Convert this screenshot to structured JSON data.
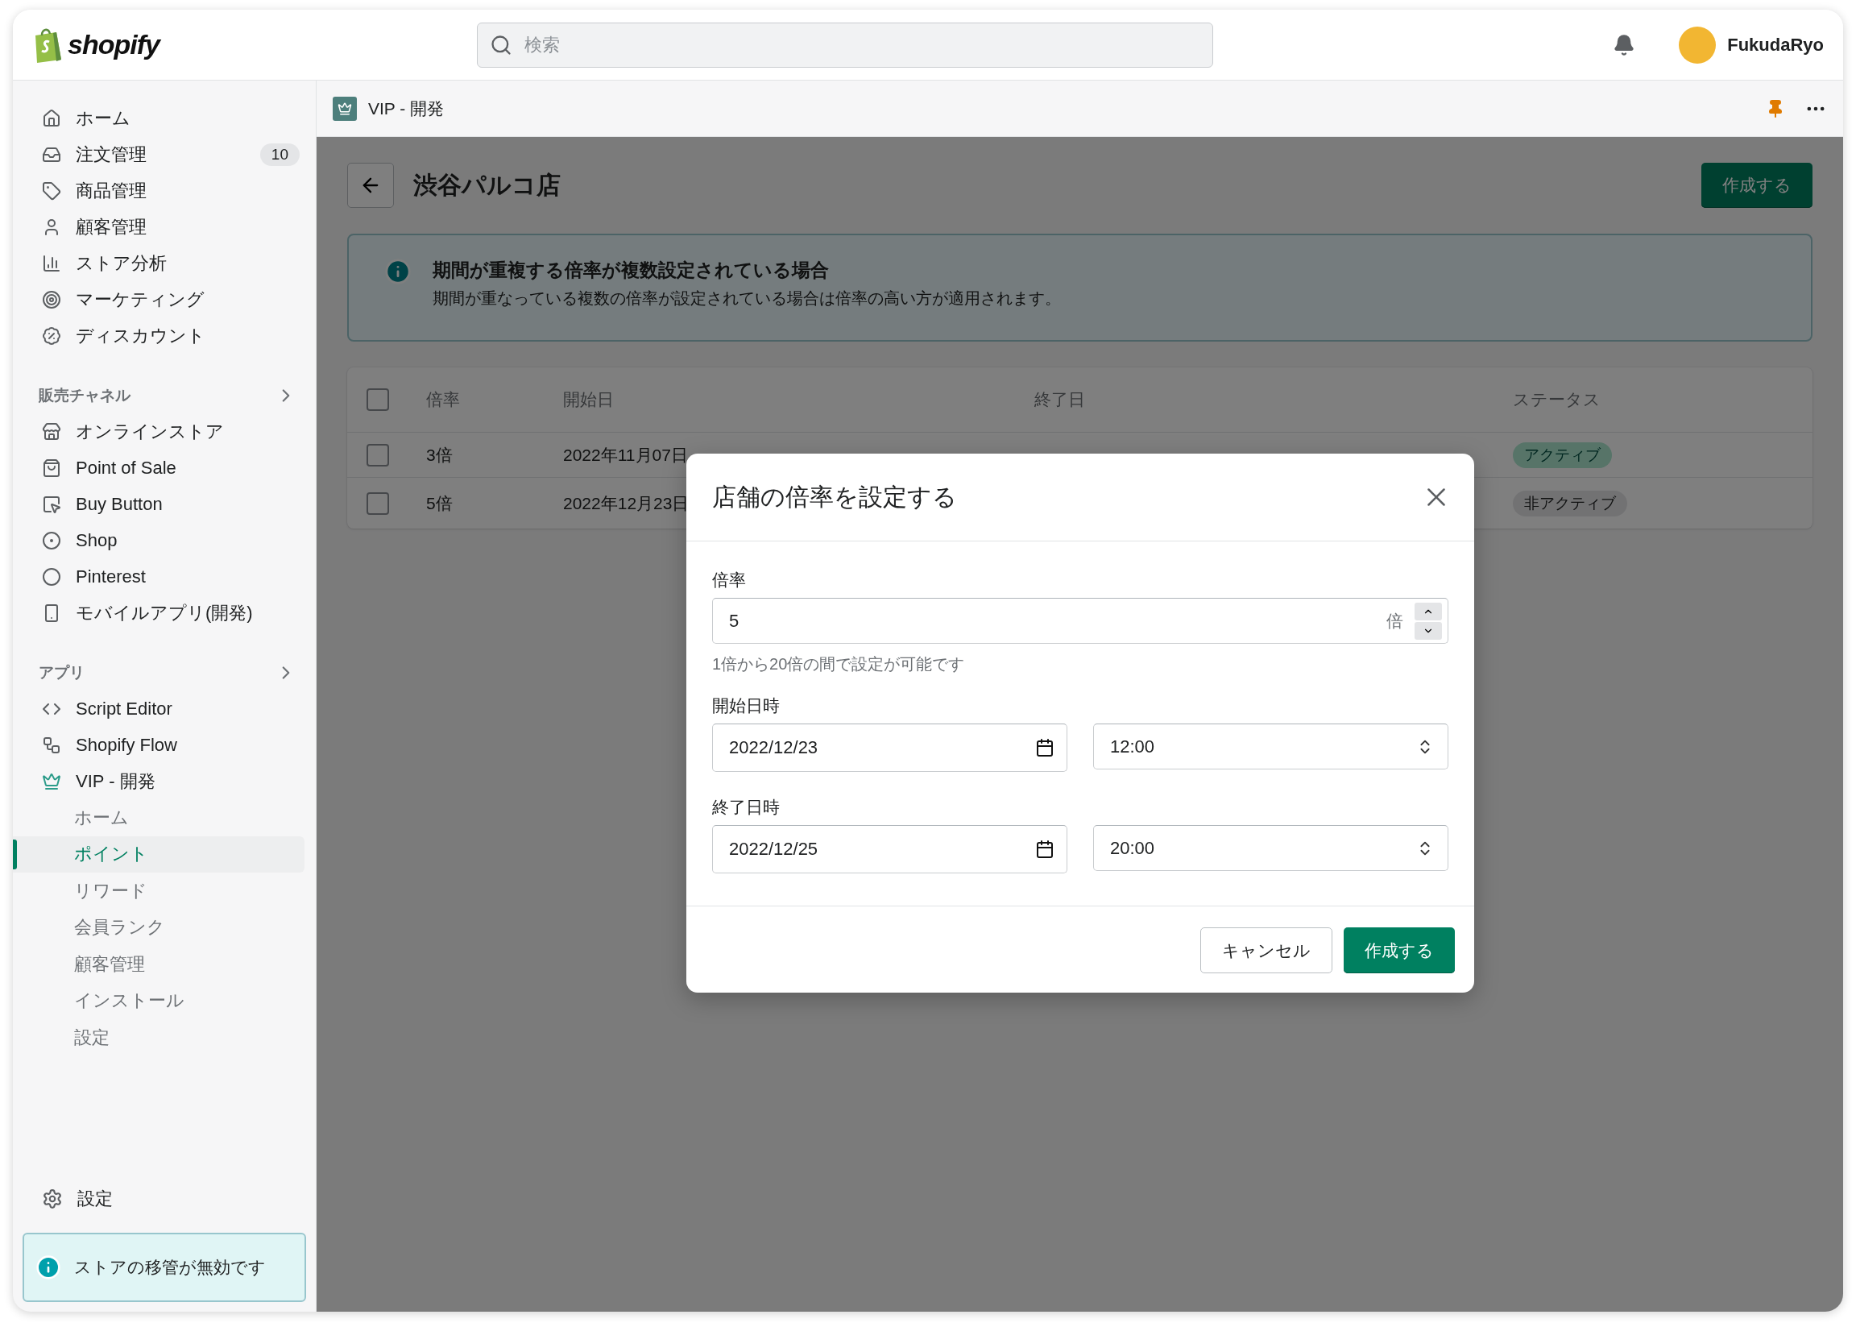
{
  "topbar": {
    "logo_text": "shopify",
    "search": {
      "placeholder": "検索"
    },
    "user": {
      "name": "FukudaRyo"
    }
  },
  "sidebar": {
    "main_items": [
      {
        "label": "ホーム"
      },
      {
        "label": "注文管理",
        "badge": "10"
      },
      {
        "label": "商品管理"
      },
      {
        "label": "顧客管理"
      },
      {
        "label": "ストア分析"
      },
      {
        "label": "マーケティング"
      },
      {
        "label": "ディスカウント"
      }
    ],
    "channels": {
      "title": "販売チャネル",
      "items": [
        {
          "label": "オンラインストア"
        },
        {
          "label": "Point of Sale"
        },
        {
          "label": "Buy Button"
        },
        {
          "label": "Shop"
        },
        {
          "label": "Pinterest"
        },
        {
          "label": "モバイルアプリ(開発)"
        }
      ]
    },
    "apps": {
      "title": "アプリ",
      "items": [
        {
          "label": "Script Editor"
        },
        {
          "label": "Shopify Flow"
        },
        {
          "label": "VIP - 開発",
          "children": [
            {
              "label": "ホーム",
              "selected": false
            },
            {
              "label": "ポイント",
              "selected": true
            },
            {
              "label": "リワード",
              "selected": false
            },
            {
              "label": "会員ランク",
              "selected": false
            },
            {
              "label": "顧客管理",
              "selected": false
            },
            {
              "label": "インストール",
              "selected": false
            },
            {
              "label": "設定",
              "selected": false
            }
          ]
        }
      ]
    },
    "settings": "設定",
    "notice": "ストアの移管が無効です"
  },
  "breadcrumb": {
    "title": "VIP - 開発"
  },
  "page": {
    "title": "渋谷パルコ店",
    "primary_button": "作成する"
  },
  "banner": {
    "title": "期間が重複する倍率が複数設定されている場合",
    "text": "期間が重なっている複数の倍率が設定されている場合は倍率の高い方が適用されます。"
  },
  "table": {
    "header_checked": false,
    "columns": [
      "倍率",
      "開始日",
      "終了日",
      "ステータス"
    ],
    "rows": [
      {
        "checked": false,
        "rate": "3倍",
        "start": "2022年11月07日",
        "status": {
          "label": "アクティブ",
          "kind": "active"
        }
      },
      {
        "checked": false,
        "rate": "5倍",
        "start": "2022年12月23日",
        "status": {
          "label": "非アクティブ",
          "kind": "inactive"
        }
      }
    ]
  },
  "modal": {
    "title": "店舗の倍率を設定する",
    "rate": {
      "label": "倍率",
      "value": "5",
      "suffix": "倍",
      "help": "1倍から20倍の間で設定が可能です"
    },
    "periods": [
      {
        "label": "開始日時",
        "date": "2022/12/23",
        "time": "12:00"
      },
      {
        "label": "終了日時",
        "date": "2022/12/25",
        "time": "20:00"
      }
    ],
    "cancel": "キャンセル",
    "submit": "作成する"
  }
}
